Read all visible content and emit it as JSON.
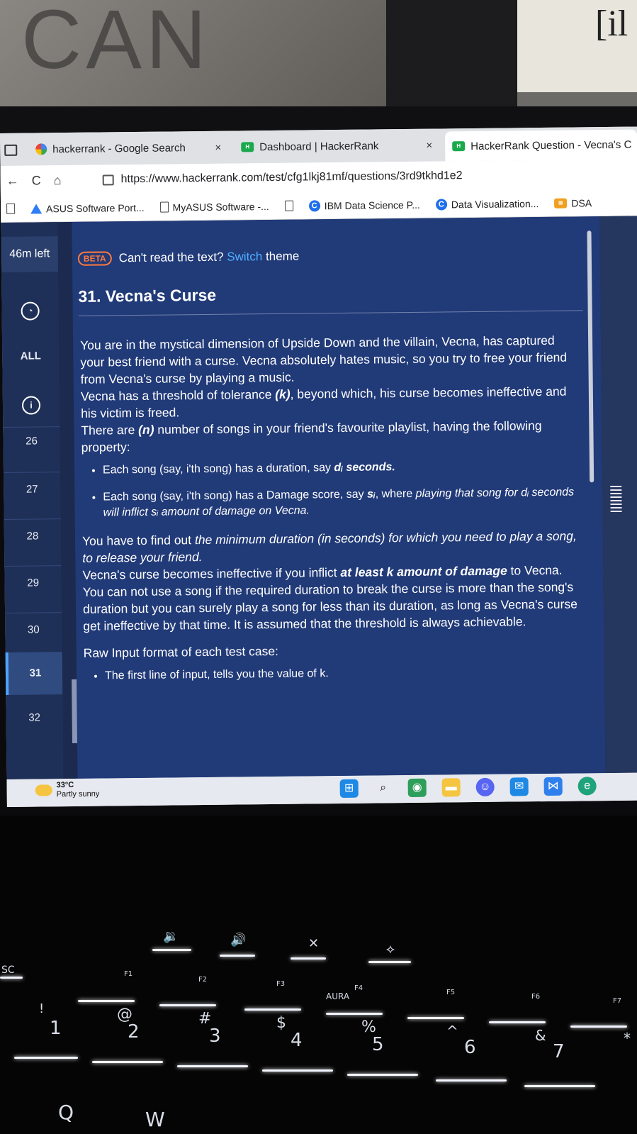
{
  "scene": {
    "wall_text": "CAN",
    "card_text": "[il"
  },
  "tabs": [
    {
      "label": "hackerrank - Google Search",
      "favicon": "google-icon",
      "active": false
    },
    {
      "label": "Dashboard | HackerRank",
      "favicon": "hackerrank-icon",
      "active": false
    },
    {
      "label": "HackerRank Question - Vecna's C",
      "favicon": "hackerrank-icon",
      "active": true
    }
  ],
  "tab_close": "×",
  "nav": {
    "back": "←",
    "reload": "C",
    "home": "⌂"
  },
  "url": "https://www.hackerrank.com/test/cfg1lkj81mf/questions/3rd9tkhd1e2",
  "bookmarks": [
    {
      "label": "ASUS Software Port...",
      "icon": "asus-icon"
    },
    {
      "label": "MyASUS Software -...",
      "icon": "page-icon"
    },
    {
      "label": "IBM Data Science P...",
      "icon": "coursera-icon"
    },
    {
      "label": "Data Visualization...",
      "icon": "coursera-icon"
    },
    {
      "label": "DSA",
      "icon": "folder-icon"
    }
  ],
  "sidebar": {
    "timer": "46m left",
    "items": [
      "ALL",
      "26",
      "27",
      "28",
      "29",
      "30",
      "31",
      "32"
    ],
    "active_item": "31"
  },
  "theme_banner": {
    "badge": "BETA",
    "text": "Can't read the text?",
    "link": "Switch",
    "suffix": "theme"
  },
  "question": {
    "title": "31. Vecna's Curse",
    "p1": "You are in the mystical dimension of Upside Down and the villain, Vecna, has captured your best friend with a curse. Vecna absolutely hates music, so you try to free your friend from Vecna's curse by playing a music.",
    "p2a": "Vecna has a threshold of tolerance ",
    "p2b": "(k)",
    "p2c": ", beyond which, his curse becomes ineffective and his victim is freed.",
    "p3a": "There are ",
    "p3b": "(n)",
    "p3c": " number of songs in your friend's favourite playlist, having the following property:",
    "b1a": "Each song (say, i'th song) has a duration, say ",
    "b1b": "dᵢ seconds.",
    "b2a": "Each song (say, i'th song) has a Damage score, say ",
    "b2b": "sᵢ",
    "b2c": ", where ",
    "b2d": "playing that song for dᵢ seconds will inflict sᵢ amount of damage on Vecna.",
    "p4a": "You have to find out ",
    "p4b": "the minimum duration (in seconds) for which you need to play a song, to release your friend.",
    "p5a": "Vecna's curse becomes ineffective if you inflict ",
    "p5b": "at least k amount of damage",
    "p5c": " to Vecna.",
    "p6": "You can not use a song if the required duration to break the curse is more than the song's duration but you can surely play a song for less than its duration, as long as Vecna's curse get ineffective by that time. It is assumed that the threshold is always achievable.",
    "p7": "Raw Input format of each test case:",
    "b3": "The first line of input, tells you the value of k."
  },
  "taskbar": {
    "temp": "33°C",
    "weather": "Partly sunny",
    "apps": [
      "windows-icon",
      "search-icon",
      "chrome-icon",
      "file-explorer-icon",
      "discord-icon",
      "mail-icon",
      "vscode-icon",
      "edge-icon"
    ]
  },
  "keyboard": {
    "keys": [
      "SC",
      "!",
      "1",
      "@",
      "2",
      "#",
      "3",
      "$",
      "4",
      "%",
      "5",
      "^",
      "6",
      "&",
      "7",
      "*",
      "Q",
      "W"
    ],
    "fn": [
      "F1",
      "F2",
      "F3",
      "F4",
      "F5",
      "F6",
      "F7"
    ],
    "aura": "AURA"
  },
  "colors": {
    "page_bg": "#213a78",
    "sidebar_bg": "#1f3058",
    "link": "#4fb0ff",
    "beta": "#ff7a3d",
    "accent": "#4fa3ff"
  }
}
